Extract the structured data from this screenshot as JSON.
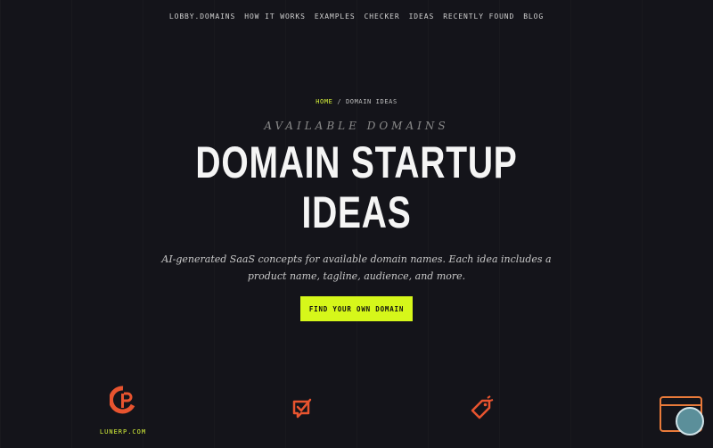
{
  "nav": {
    "items": [
      "LOBBY.DOMAINS",
      "HOW IT WORKS",
      "EXAMPLES",
      "CHECKER",
      "IDEAS",
      "RECENTLY FOUND",
      "BLOG"
    ]
  },
  "breadcrumb": {
    "home": "HOME",
    "separator": "/",
    "current": "DOMAIN IDEAS"
  },
  "hero": {
    "eyebrow": "AVAILABLE DOMAINS",
    "title_line1": "DOMAIN STARTUP",
    "title_line2": "IDEAS",
    "subtitle": "AI-generated SaaS concepts for available domain names. Each idea includes a product name, tagline, audience, and more.",
    "cta_label": "FIND YOUR OWN DOMAIN"
  },
  "cards": [
    {
      "icon": "p-logo-icon",
      "label": "LUNERP.COM"
    },
    {
      "icon": "checkbox-message-icon",
      "label": ""
    },
    {
      "icon": "tag-icon",
      "label": ""
    }
  ],
  "colors": {
    "accent": "#d6f71a",
    "background": "#14141a",
    "icon_orange": "#e8542f"
  }
}
